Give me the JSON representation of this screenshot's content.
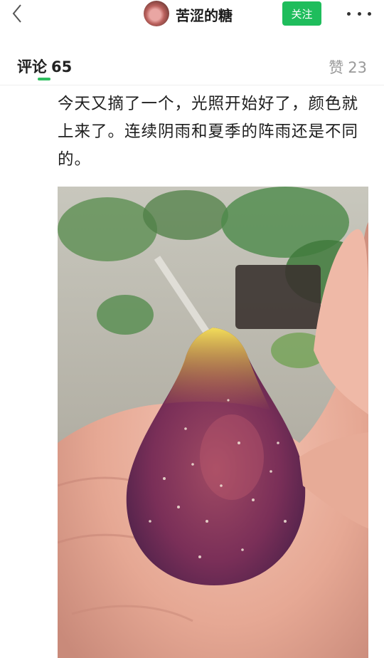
{
  "header": {
    "author_name": "苦涩的糖",
    "follow_label": "关注",
    "back_icon": "chevron-left-icon",
    "more_icon": "more-horizontal-icon"
  },
  "tabs": {
    "comments_label": "评论",
    "comments_count": "65",
    "likes_label": "赞",
    "likes_count": "23",
    "active_color": "#2fbf5f"
  },
  "comment": {
    "text": "今天又摘了一个，光照开始好了，颜色就上来了。连续阴雨和夏季的阵雨还是不同的。"
  },
  "colors": {
    "follow_button": "#1fbd5c",
    "muted_text": "#9a9a9a"
  }
}
